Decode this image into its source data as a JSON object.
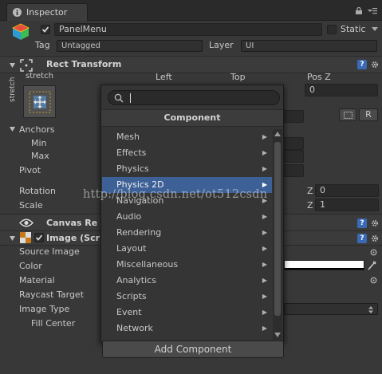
{
  "tab": {
    "title": "Inspector"
  },
  "object": {
    "name": "PanelMenu",
    "static_label": "Static",
    "tag_label": "Tag",
    "tag_value": "Untagged",
    "layer_label": "Layer",
    "layer_value": "UI"
  },
  "rect_transform": {
    "title": "Rect Transform",
    "anchor_preset": "stretch",
    "col_left": "Left",
    "col_top": "Top",
    "col_posz": "Pos Z",
    "posz_value": "0",
    "stretch_side": "stretch",
    "anchors_label": "Anchors",
    "min_label": "Min",
    "max_label": "Max",
    "pivot_label": "Pivot",
    "rotation_label": "Rotation",
    "scale_label": "Scale",
    "rot_z_label": "Z",
    "rot_z_value": "0",
    "scale_z_label": "Z",
    "scale_z_value": "1",
    "r_button": "R"
  },
  "canvas_renderer": {
    "title": "Canvas Re"
  },
  "image": {
    "title": "Image (Scr",
    "source_image_label": "Source Image",
    "color_label": "Color",
    "material_label": "Material",
    "raycast_label": "Raycast Target",
    "image_type_label": "Image Type",
    "fill_center_label": "Fill Center"
  },
  "popup": {
    "search_value": "",
    "title": "Component",
    "items": [
      {
        "label": "Mesh",
        "arrow": "▶"
      },
      {
        "label": "Effects",
        "arrow": "▶"
      },
      {
        "label": "Physics",
        "arrow": "▶"
      },
      {
        "label": "Physics 2D",
        "arrow": "▶"
      },
      {
        "label": "Navigation",
        "arrow": "▶"
      },
      {
        "label": "Audio",
        "arrow": "▶"
      },
      {
        "label": "Rendering",
        "arrow": "▶"
      },
      {
        "label": "Layout",
        "arrow": "▶"
      },
      {
        "label": "Miscellaneous",
        "arrow": "▶"
      },
      {
        "label": "Analytics",
        "arrow": "▶"
      },
      {
        "label": "Scripts",
        "arrow": "▶"
      },
      {
        "label": "Event",
        "arrow": "▶"
      },
      {
        "label": "Network",
        "arrow": "▶"
      }
    ],
    "selected_index": 3
  },
  "add_component": {
    "label": "Add Component"
  },
  "watermark": {
    "text": "http://blog.csdn.net/ot512csdn"
  },
  "colors": {
    "selection": "#3d6196",
    "background": "#383838",
    "help_icon": "#3a6ab5"
  },
  "icons": [
    "cube-icon",
    "lock-icon",
    "menu-icon",
    "move-tool-icon",
    "help-icon",
    "gear-icon",
    "eye-icon",
    "search-icon",
    "chevron-right-icon",
    "eyedropper-icon",
    "circle-select-icon",
    "blueprint-icon"
  ]
}
